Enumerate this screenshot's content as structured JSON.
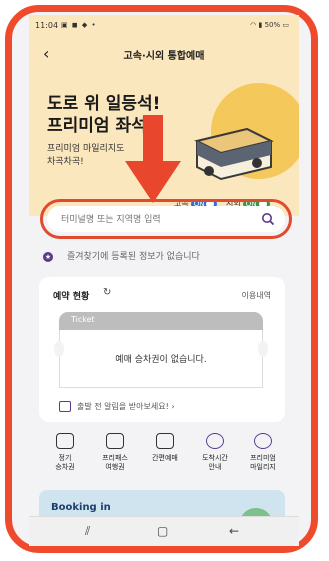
{
  "status_bar": {
    "time": "11:04",
    "battery": "50%"
  },
  "header": {
    "back_icon": "back-arrow-icon",
    "title": "고속·시외 통합예매"
  },
  "banner": {
    "headline_line1": "도로 위 일등석!",
    "headline_line2": "프리미엄 좌석",
    "sub_line1": "프리미엄 마일리지도",
    "sub_line2": "차곡차곡!",
    "toggle_express_label": "고속",
    "toggle_express_state": "ON",
    "toggle_intercity_label": "시외",
    "toggle_intercity_state": "ON",
    "colors": {
      "background": "#fbe7bd",
      "sun": "#f5c85c",
      "express_toggle": "#2f6fd6",
      "intercity_toggle": "#2e9b46"
    }
  },
  "search": {
    "placeholder": "터미널명 또는 지역명 입력"
  },
  "favorites": {
    "empty_text": "즐겨찾기에 등록된 정보가 없습니다"
  },
  "reservation": {
    "title": "예약 현황",
    "history_link": "이용내역",
    "ticket_label": "Ticket",
    "empty_text": "예매 승차권이 없습니다.",
    "tip_text": "출발 전 알림을 받아보세요!"
  },
  "quick_menu": [
    {
      "label_line1": "정기",
      "label_line2": "승차권",
      "icon": "ticket-wallet-icon"
    },
    {
      "label_line1": "프리패스",
      "label_line2": "여행권",
      "icon": "pass-icon"
    },
    {
      "label_line1": "간편예매",
      "label_line2": "",
      "icon": "quick-booking-icon"
    },
    {
      "label_line1": "도착시간",
      "label_line2": "안내",
      "icon": "clock-icon"
    },
    {
      "label_line1": "프리미엄",
      "label_line2": "마일리지",
      "icon": "mileage-icon"
    }
  ],
  "booking_banner": {
    "text": "Booking in"
  },
  "nav_bar": {
    "recent_icon": "recent-apps-icon",
    "home_icon": "home-icon",
    "back_icon": "back-icon"
  },
  "annotation": {
    "frame_color": "#f04a2d",
    "arrow_color": "#e8472d"
  }
}
